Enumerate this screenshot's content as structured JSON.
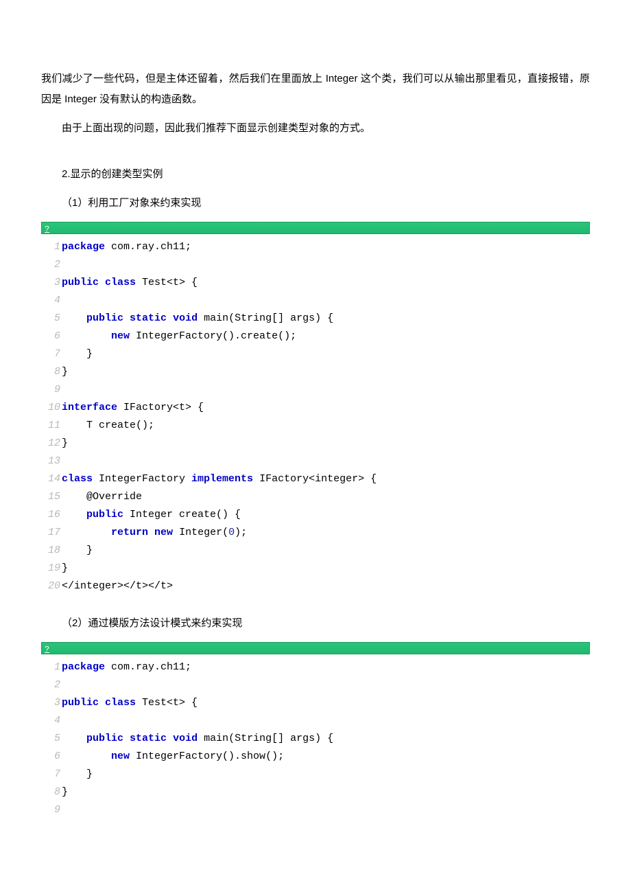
{
  "paragraphs": {
    "p1": "我们减少了一些代码，但是主体还留着，然后我们在里面放上 Integer 这个类，我们可以从输出那里看见，直接报错，原因是 Integer 没有默认的构造函数。",
    "p2": "由于上面出现的问题，因此我们推荐下面显示创建类型对象的方式。",
    "p3": "2.显示的创建类型实例",
    "p4": "（1）利用工厂对象来约束实现",
    "p5": "（2）通过模版方法设计模式来约束实现"
  },
  "codeHeader": "?",
  "code1": {
    "lines": [
      {
        "n": "1",
        "tokens": [
          {
            "t": "package",
            "c": "kw"
          },
          {
            "t": " com.ray.ch11;"
          }
        ]
      },
      {
        "n": "2",
        "tokens": []
      },
      {
        "n": "3",
        "tokens": [
          {
            "t": "public",
            "c": "kw"
          },
          {
            "t": " "
          },
          {
            "t": "class",
            "c": "kw"
          },
          {
            "t": " Test<t> {"
          }
        ]
      },
      {
        "n": "4",
        "tokens": []
      },
      {
        "n": "5",
        "tokens": [
          {
            "t": "    "
          },
          {
            "t": "public",
            "c": "kw"
          },
          {
            "t": " "
          },
          {
            "t": "static",
            "c": "kw"
          },
          {
            "t": " "
          },
          {
            "t": "void",
            "c": "kw"
          },
          {
            "t": " main(String[] args) {"
          }
        ]
      },
      {
        "n": "6",
        "tokens": [
          {
            "t": "        "
          },
          {
            "t": "new",
            "c": "kw"
          },
          {
            "t": " IntegerFactory().create();"
          }
        ]
      },
      {
        "n": "7",
        "tokens": [
          {
            "t": "    }"
          }
        ]
      },
      {
        "n": "8",
        "tokens": [
          {
            "t": "}"
          }
        ]
      },
      {
        "n": "9",
        "tokens": []
      },
      {
        "n": "10",
        "tokens": [
          {
            "t": "interface",
            "c": "kw"
          },
          {
            "t": " IFactory<t> {"
          }
        ]
      },
      {
        "n": "11",
        "tokens": [
          {
            "t": "    T create();"
          }
        ]
      },
      {
        "n": "12",
        "tokens": [
          {
            "t": "}"
          }
        ]
      },
      {
        "n": "13",
        "tokens": []
      },
      {
        "n": "14",
        "tokens": [
          {
            "t": "class",
            "c": "kw"
          },
          {
            "t": " IntegerFactory "
          },
          {
            "t": "implements",
            "c": "kw"
          },
          {
            "t": " IFactory<integer> {"
          }
        ]
      },
      {
        "n": "15",
        "tokens": [
          {
            "t": "    @Override"
          }
        ]
      },
      {
        "n": "16",
        "tokens": [
          {
            "t": "    "
          },
          {
            "t": "public",
            "c": "kw"
          },
          {
            "t": " Integer create() {"
          }
        ]
      },
      {
        "n": "17",
        "tokens": [
          {
            "t": "        "
          },
          {
            "t": "return",
            "c": "kw"
          },
          {
            "t": " "
          },
          {
            "t": "new",
            "c": "kw"
          },
          {
            "t": " Integer("
          },
          {
            "t": "0",
            "c": "num"
          },
          {
            "t": ");"
          }
        ]
      },
      {
        "n": "18",
        "tokens": [
          {
            "t": "    }"
          }
        ]
      },
      {
        "n": "19",
        "tokens": [
          {
            "t": "}"
          }
        ]
      },
      {
        "n": "20",
        "tokens": [
          {
            "t": "</integer></t></t>"
          }
        ]
      }
    ]
  },
  "code2": {
    "lines": [
      {
        "n": "1",
        "tokens": [
          {
            "t": "package",
            "c": "kw"
          },
          {
            "t": " com.ray.ch11;"
          }
        ]
      },
      {
        "n": "2",
        "tokens": []
      },
      {
        "n": "3",
        "tokens": [
          {
            "t": "public",
            "c": "kw"
          },
          {
            "t": " "
          },
          {
            "t": "class",
            "c": "kw"
          },
          {
            "t": " Test<t> {"
          }
        ]
      },
      {
        "n": "4",
        "tokens": []
      },
      {
        "n": "5",
        "tokens": [
          {
            "t": "    "
          },
          {
            "t": "public",
            "c": "kw"
          },
          {
            "t": " "
          },
          {
            "t": "static",
            "c": "kw"
          },
          {
            "t": " "
          },
          {
            "t": "void",
            "c": "kw"
          },
          {
            "t": " main(String[] args) {"
          }
        ]
      },
      {
        "n": "6",
        "tokens": [
          {
            "t": "        "
          },
          {
            "t": "new",
            "c": "kw"
          },
          {
            "t": " IntegerFactory().show();"
          }
        ]
      },
      {
        "n": "7",
        "tokens": [
          {
            "t": "    }"
          }
        ]
      },
      {
        "n": "8",
        "tokens": [
          {
            "t": "}"
          }
        ]
      },
      {
        "n": "9",
        "tokens": []
      }
    ]
  }
}
